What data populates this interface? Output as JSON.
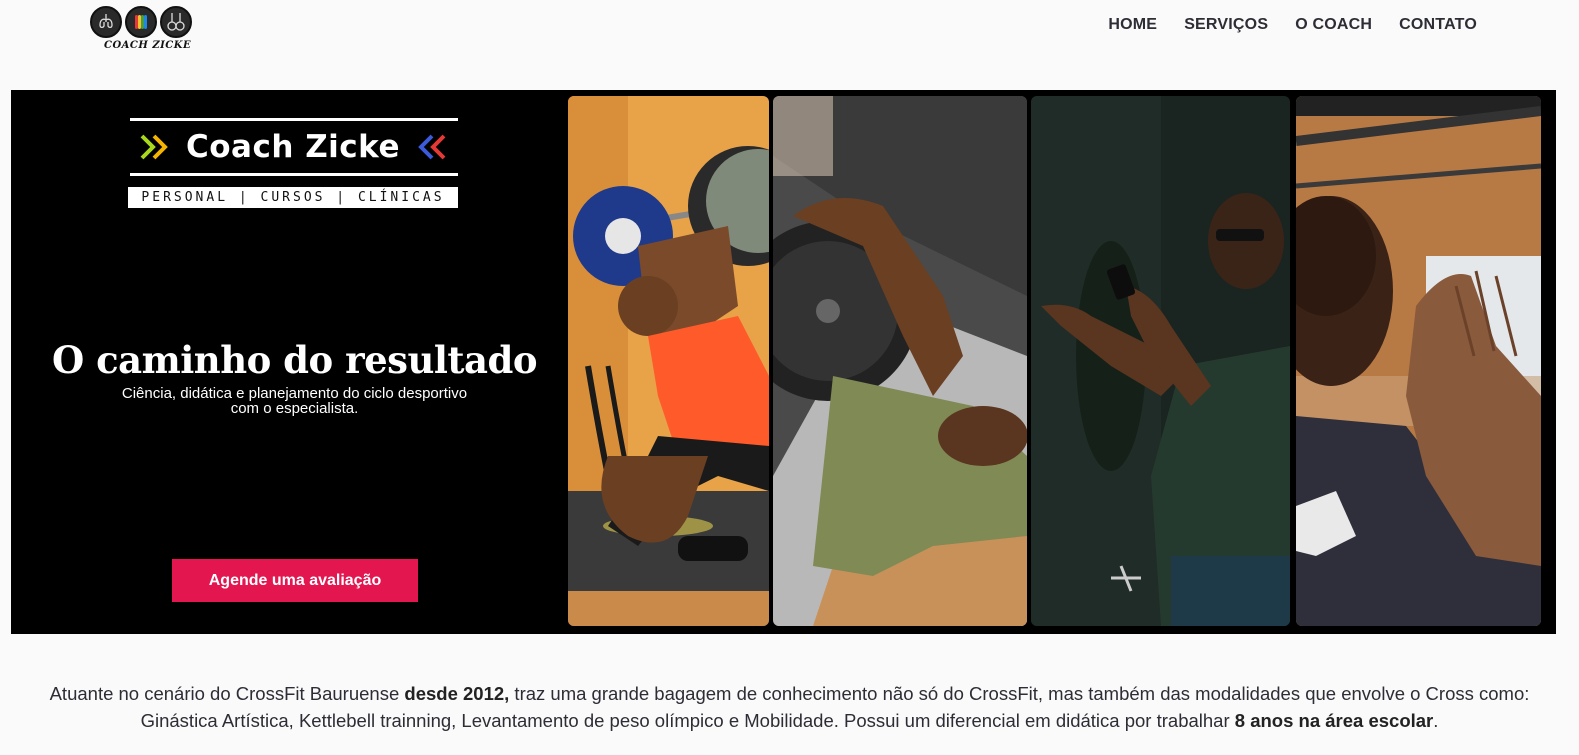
{
  "logo": {
    "text": "COACH ZICKE",
    "icons": [
      "lungs-icon",
      "heart-rainbow-icon",
      "rings-icon"
    ]
  },
  "nav": {
    "items": [
      {
        "label": "HOME"
      },
      {
        "label": "SERVIÇOS"
      },
      {
        "label": "O COACH"
      },
      {
        "label": "CONTATO"
      }
    ]
  },
  "hero": {
    "brand_title": "Coach Zicke",
    "brand_subtitle": "PERSONAL | CURSOS | CLÍNICAS",
    "headline": "O caminho do resultado",
    "tagline": "Ciência, didática e planejamento do ciclo desportivo com o especialista.",
    "cta_label": "Agende uma avaliação",
    "photos": [
      "squat-snatch-photo",
      "bench-press-photo",
      "coach-with-phone-photo",
      "coach-clapping-photo"
    ]
  },
  "about": {
    "part1": "Atuante no cenário do CrossFit Bauruense ",
    "bold1": "desde 2012,",
    "part2": " traz uma grande bagagem de conhecimento não só do CrossFit, mas também das modalidades que envolve o Cross como: Ginástica Artística, Kettlebell trainning, Levantamento de peso olímpico e Mobilidade. Possui um diferencial em didática por trabalhar ",
    "bold2": "8 anos na área escolar",
    "part3": "."
  },
  "colors": {
    "accent": "#e3164f",
    "hero_bg": "#000000",
    "page_bg": "#fafafa",
    "chevron_left": "#a8d81c",
    "chevron_right": "#3b5bdb"
  }
}
